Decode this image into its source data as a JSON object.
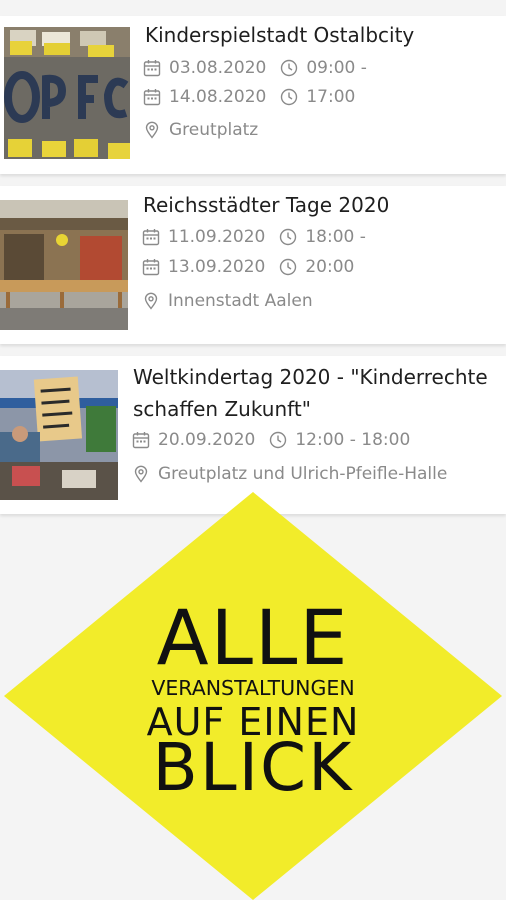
{
  "events": [
    {
      "title": "Kinderspielstadt Ostalbcity",
      "start_date": "03.08.2020",
      "start_time": "09:00 -",
      "end_date": "14.08.2020",
      "end_time": "17:00",
      "location": "Greutplatz"
    },
    {
      "title": "Reichsstädter Tage 2020",
      "start_date": "11.09.2020",
      "start_time": "18:00 -",
      "end_date": "13.09.2020",
      "end_time": "20:00",
      "location": "Innenstadt Aalen"
    },
    {
      "title_line1": "Weltkindertag 2020 - \"Kinderrechte",
      "title_line2": "schaffen Zukunft\"",
      "date": "20.09.2020",
      "time": "12:00 - 18:00",
      "location": "Greutplatz und Ulrich-Pfeifle-Halle"
    }
  ],
  "banner": {
    "line1": "ALLE",
    "line2": "VERANSTALTUNGEN",
    "line3": "AUF EINEN",
    "line4": "BLICK",
    "color": "#f2ec2a"
  },
  "colors": {
    "background": "#f4f4f4",
    "card": "#ffffff",
    "title_text": "#1f1f1f",
    "meta_text": "#8a8a8a"
  },
  "icons": [
    "calendar-icon",
    "clock-icon",
    "location-pin-icon"
  ]
}
